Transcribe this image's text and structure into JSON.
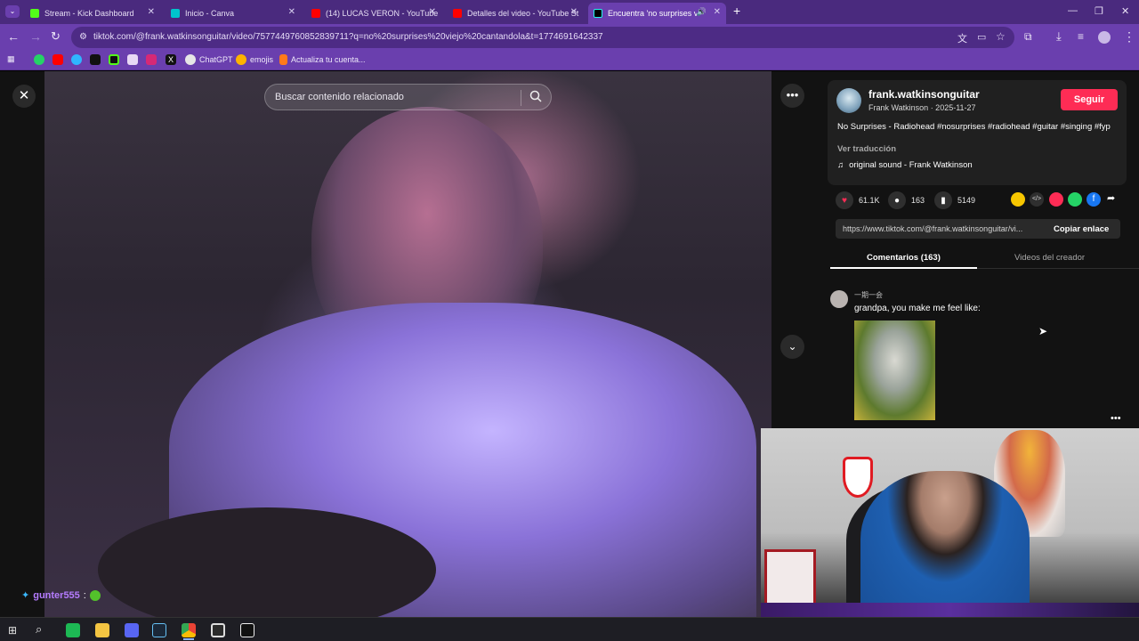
{
  "browser": {
    "tabs": [
      {
        "label": "Stream - Kick Dashboard",
        "color": "#53fc18"
      },
      {
        "label": "Inicio - Canva",
        "color": "#00c4cc"
      },
      {
        "label": "(14) LUCAS VERON - YouTube",
        "color": "#ff0000"
      },
      {
        "label": "Detalles del video - YouTube St",
        "color": "#ff0000"
      },
      {
        "label": "Encuentra 'no surprises viej",
        "color": "#000000"
      }
    ],
    "url": "tiktok.com/@frank.watkinsonguitar/video/7577449760852839711?q=no%20surprises%20viejo%20cantandola&t=1774691642337",
    "bookmarks": [
      {
        "label": "ChatGPT"
      },
      {
        "label": "emojis"
      },
      {
        "label": "Actualiza tu cuenta..."
      }
    ]
  },
  "search": {
    "placeholder": "Buscar contenido relacionado"
  },
  "creator": {
    "username": "frank.watkinsonguitar",
    "name_date": "Frank Watkinson · 2025-11-27",
    "follow_label": "Seguir",
    "caption": "No Surprises - Radiohead #nosurprises #radiohead #guitar #singing #fyp",
    "translate_label": "Ver traducción",
    "sound": "original sound - Frank Watkinson"
  },
  "stats": {
    "likes": "61.1K",
    "comments": "163",
    "saves": "5149"
  },
  "link": {
    "url": "https://www.tiktok.com/@frank.watkinsonguitar/vi...",
    "copy_label": "Copiar enlace"
  },
  "panel_tabs": {
    "comments": "Comentarios (163)",
    "videos": "Videos del creador"
  },
  "comment": {
    "user": "一期一会",
    "text": "grandpa, you make me feel like:"
  },
  "chat": {
    "user": "gunter555",
    "sep": ":"
  },
  "colors": {
    "accent": "#fe2c55",
    "chrome": "#6a3fae",
    "tabbar": "#4a2a7e"
  }
}
